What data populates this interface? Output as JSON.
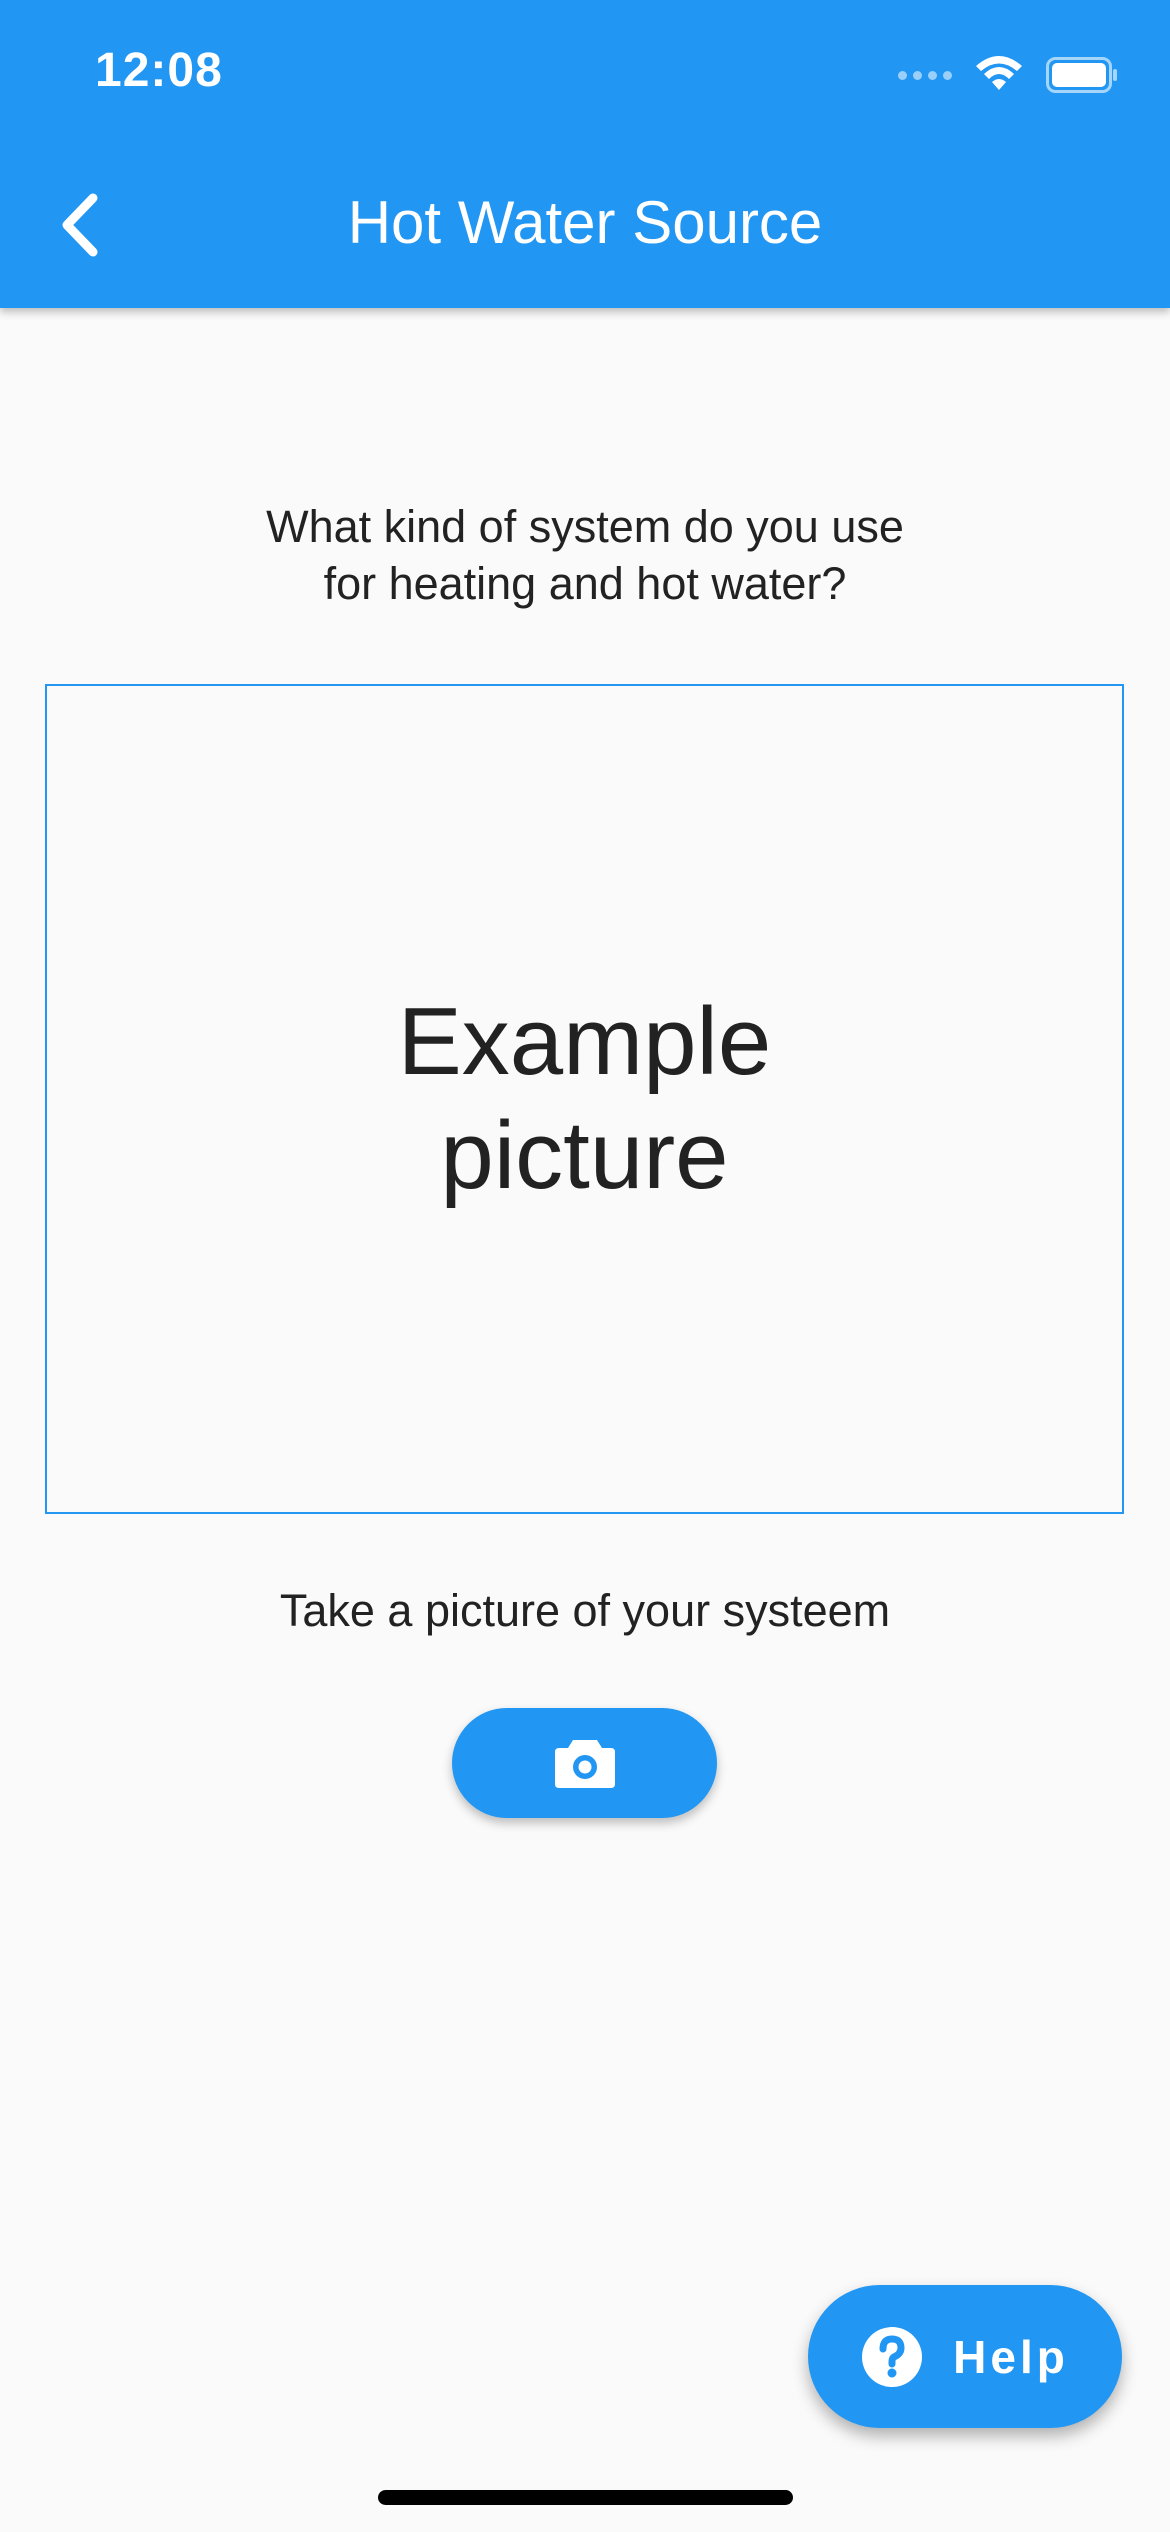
{
  "status_bar": {
    "time": "12:08"
  },
  "app_bar": {
    "title": "Hot Water Source",
    "back_icon": "chevron-left-icon",
    "color": "#2196f3"
  },
  "content": {
    "question_lines": [
      "What kind of system do you use",
      "for heating and hot water?"
    ],
    "example_lines": [
      "Example",
      "picture"
    ],
    "take_picture_text": "Take a picture of your systeem",
    "camera_icon": "camera-icon"
  },
  "help_button": {
    "label": "Help",
    "icon": "help-circle-icon"
  },
  "colors": {
    "accent": "#2196f3",
    "background": "#fafafa",
    "text": "#222222"
  }
}
